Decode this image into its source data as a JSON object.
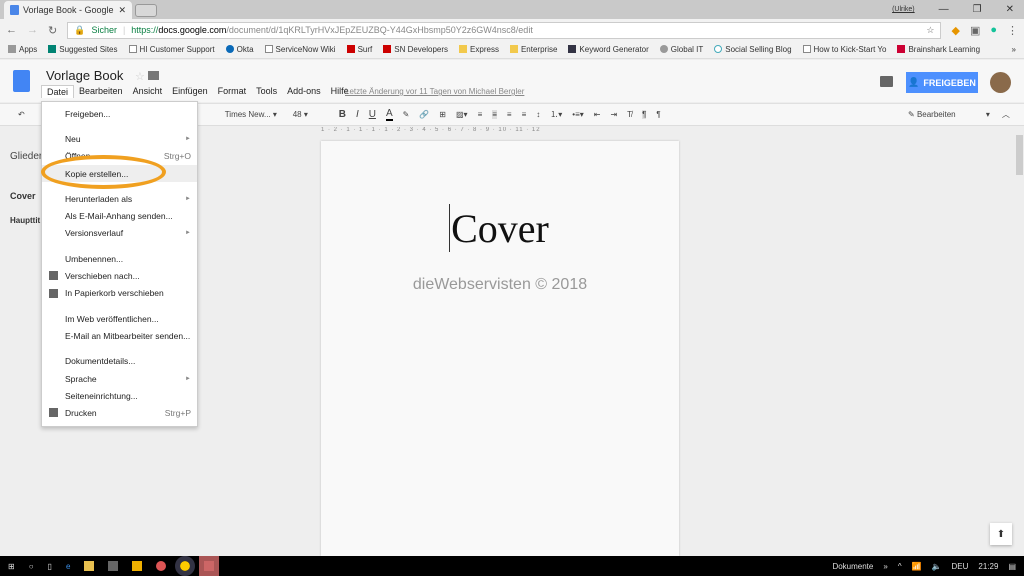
{
  "browser": {
    "tab_title": "Vorlage Book - Google D",
    "user": "(Ulrike)",
    "secure_label": "Sicher",
    "url_scheme": "https://",
    "url_host": "docs.google.com",
    "url_path": "/document/d/1qKRLTyrHVxJEpZEUZBQ-Y44GxHbsmp50Y2z6GW4nsc8/edit",
    "bookmarks": [
      "Apps",
      "Suggested Sites",
      "HI Customer Support",
      "Okta",
      "ServiceNow Wiki",
      "Surf",
      "SN Developers",
      "Express",
      "Enterprise",
      "Keyword Generator",
      "Global IT",
      "Social Selling Blog",
      "How to Kick-Start Yo",
      "Brainshark Learning"
    ]
  },
  "doc": {
    "title": "Vorlage Book",
    "menus": [
      "Datei",
      "Bearbeiten",
      "Ansicht",
      "Einfügen",
      "Format",
      "Tools",
      "Add-ons",
      "Hilfe"
    ],
    "last_edit": "Letzte Änderung vor 11 Tagen von Michael Bergler",
    "share_label": "FREIGEBEN",
    "edit_mode": "Bearbeiten"
  },
  "toolbar": {
    "font": "Times New...",
    "size": "48",
    "bold": "B",
    "italic": "I",
    "underline": "U",
    "color": "A"
  },
  "ruler": "1 · 2 · 1 · 1 · 1 · 1 · 2 · 3 · 4 · 5 · 6 · 7 · 8 · 9 · 10 · 11 · 12",
  "outline": {
    "title": "Glieder",
    "items": [
      "Cover",
      "Haupttit"
    ]
  },
  "page": {
    "heading": "Cover",
    "watermark": "dieWebservisten © 2018"
  },
  "file_menu": [
    {
      "label": "Freigeben..."
    },
    {
      "sep": true
    },
    {
      "label": "Neu",
      "arrow": true
    },
    {
      "label": "Öffnen...",
      "shortcut": "Strg+O"
    },
    {
      "label": "Kopie erstellen...",
      "highlight": true
    },
    {
      "sep": true
    },
    {
      "label": "Herunterladen als",
      "arrow": true
    },
    {
      "label": "Als E-Mail-Anhang senden..."
    },
    {
      "label": "Versionsverlauf",
      "arrow": true
    },
    {
      "sep": true
    },
    {
      "label": "Umbenennen..."
    },
    {
      "label": "Verschieben nach...",
      "icon": "folder-icon"
    },
    {
      "label": "In Papierkorb verschieben",
      "icon": "trash-icon"
    },
    {
      "sep": true
    },
    {
      "label": "Im Web veröffentlichen..."
    },
    {
      "label": "E-Mail an Mitbearbeiter senden..."
    },
    {
      "sep": true
    },
    {
      "label": "Dokumentdetails..."
    },
    {
      "label": "Sprache",
      "arrow": true
    },
    {
      "label": "Seiteneinrichtung..."
    },
    {
      "label": "Drucken",
      "shortcut": "Strg+P",
      "icon": "print-icon"
    }
  ],
  "taskbar": {
    "toolbar_label": "Dokumente",
    "lang": "DEU",
    "time": "21:29"
  },
  "colors": {
    "accent": "#4d90fe",
    "highlight_ring": "#f0a020",
    "doc_icon": "#4285f4"
  }
}
